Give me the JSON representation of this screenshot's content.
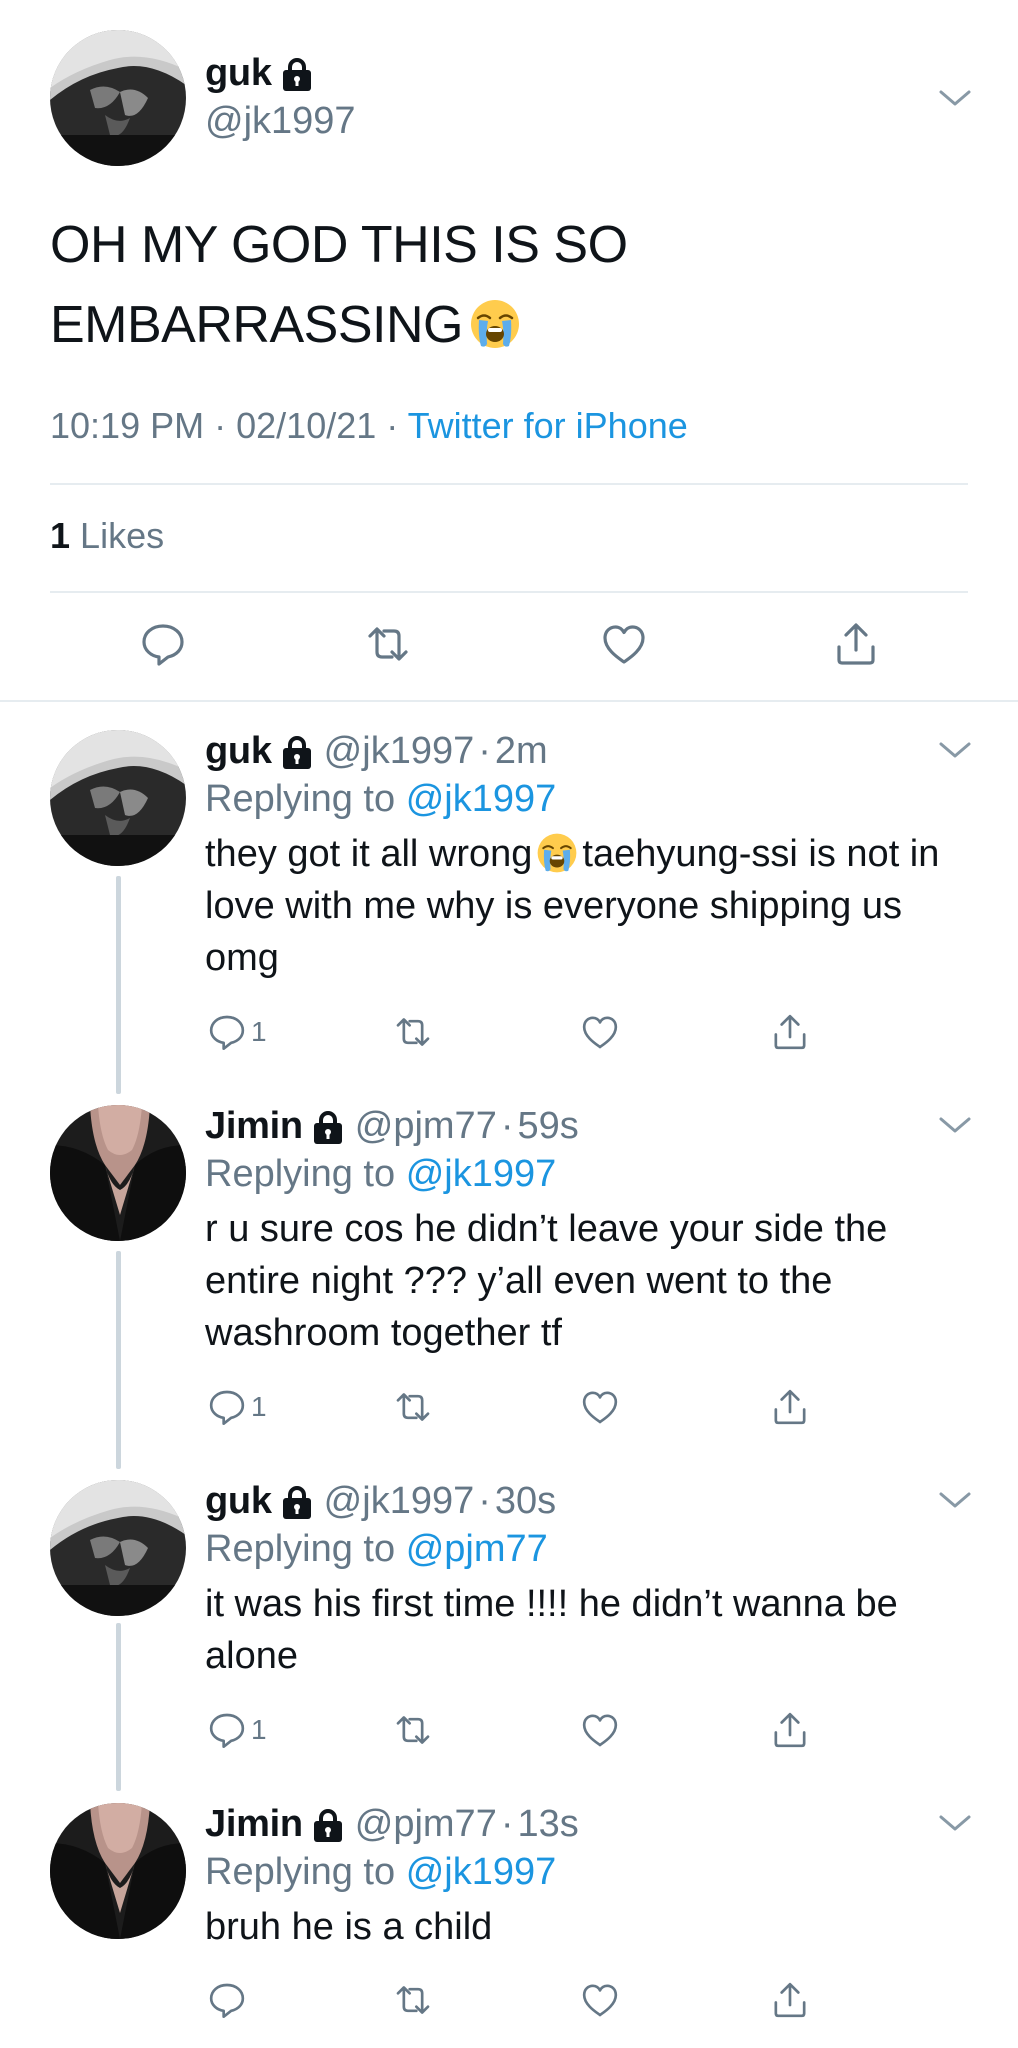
{
  "main_tweet": {
    "display_name": "guk",
    "handle": "@jk1997",
    "text": "OH MY GOD THIS IS SO EMBARRASSING",
    "time": "10:19 PM",
    "date": "02/10/21",
    "source": "Twitter for iPhone",
    "likes_count": "1",
    "likes_label": "Likes"
  },
  "replies": [
    {
      "display_name": "guk",
      "handle": "@jk1997",
      "age": "2m",
      "replying_label": "Replying to",
      "replying_to": "@jk1997",
      "text_before_emoji": "they got it all wrong",
      "text_after_emoji": "taehyung-ssi is not in love with me why is everyone shipping us omg",
      "reply_count": "1"
    },
    {
      "display_name": "Jimin",
      "handle": "@pjm77",
      "age": "59s",
      "replying_label": "Replying to",
      "replying_to": "@jk1997",
      "text": "r u sure cos he didn’t leave your side the entire night ??? y’all even went to the washroom together tf",
      "reply_count": "1"
    },
    {
      "display_name": "guk",
      "handle": "@jk1997",
      "age": "30s",
      "replying_label": "Replying to",
      "replying_to": "@pjm77",
      "text": "it was his first time !!!! he didn’t wanna be alone",
      "reply_count": "1"
    },
    {
      "display_name": "Jimin",
      "handle": "@pjm77",
      "age": "13s",
      "replying_label": "Replying to",
      "replying_to": "@jk1997",
      "text": "bruh he is a child",
      "reply_count": ""
    }
  ],
  "separators": {
    "dot": "·"
  },
  "icons": {
    "lock": "lock-icon",
    "chevron": "chevron-down-icon",
    "reply": "reply-icon",
    "retweet": "retweet-icon",
    "like": "heart-icon",
    "share": "share-icon",
    "emoji": "loudly-crying-face-emoji"
  },
  "colors": {
    "link": "#1b95e0",
    "secondary_text": "#657786",
    "divider": "#e6ecf0",
    "thread_line": "#ccd6dd"
  }
}
